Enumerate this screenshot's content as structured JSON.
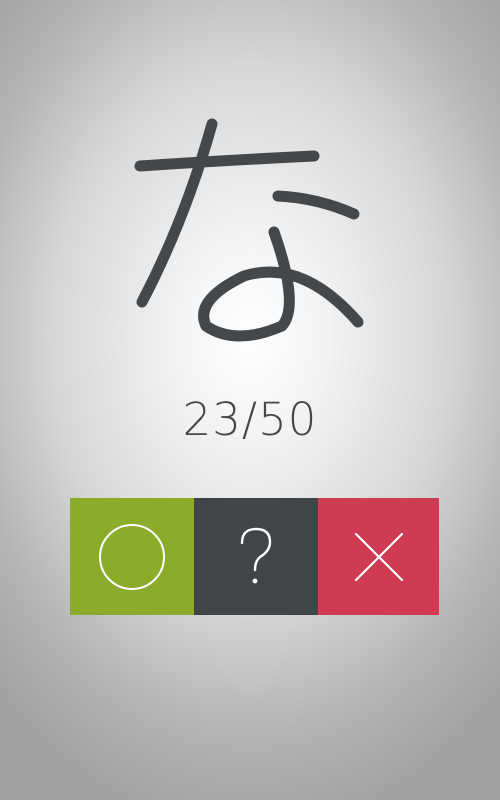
{
  "card": {
    "character": "な",
    "character_icon": "hiragana-na-glyph"
  },
  "progress": {
    "label": "23/50",
    "current": 23,
    "total": 50
  },
  "actions": {
    "correct": {
      "icon": "circle-outline-icon",
      "color": "#8bab2a"
    },
    "hint": {
      "icon": "question-mark-icon",
      "color": "#424548"
    },
    "wrong": {
      "icon": "x-cross-icon",
      "color": "#cf3b53"
    }
  },
  "colors": {
    "glyph": "#45484b",
    "icon_stroke": "#ffffff"
  }
}
